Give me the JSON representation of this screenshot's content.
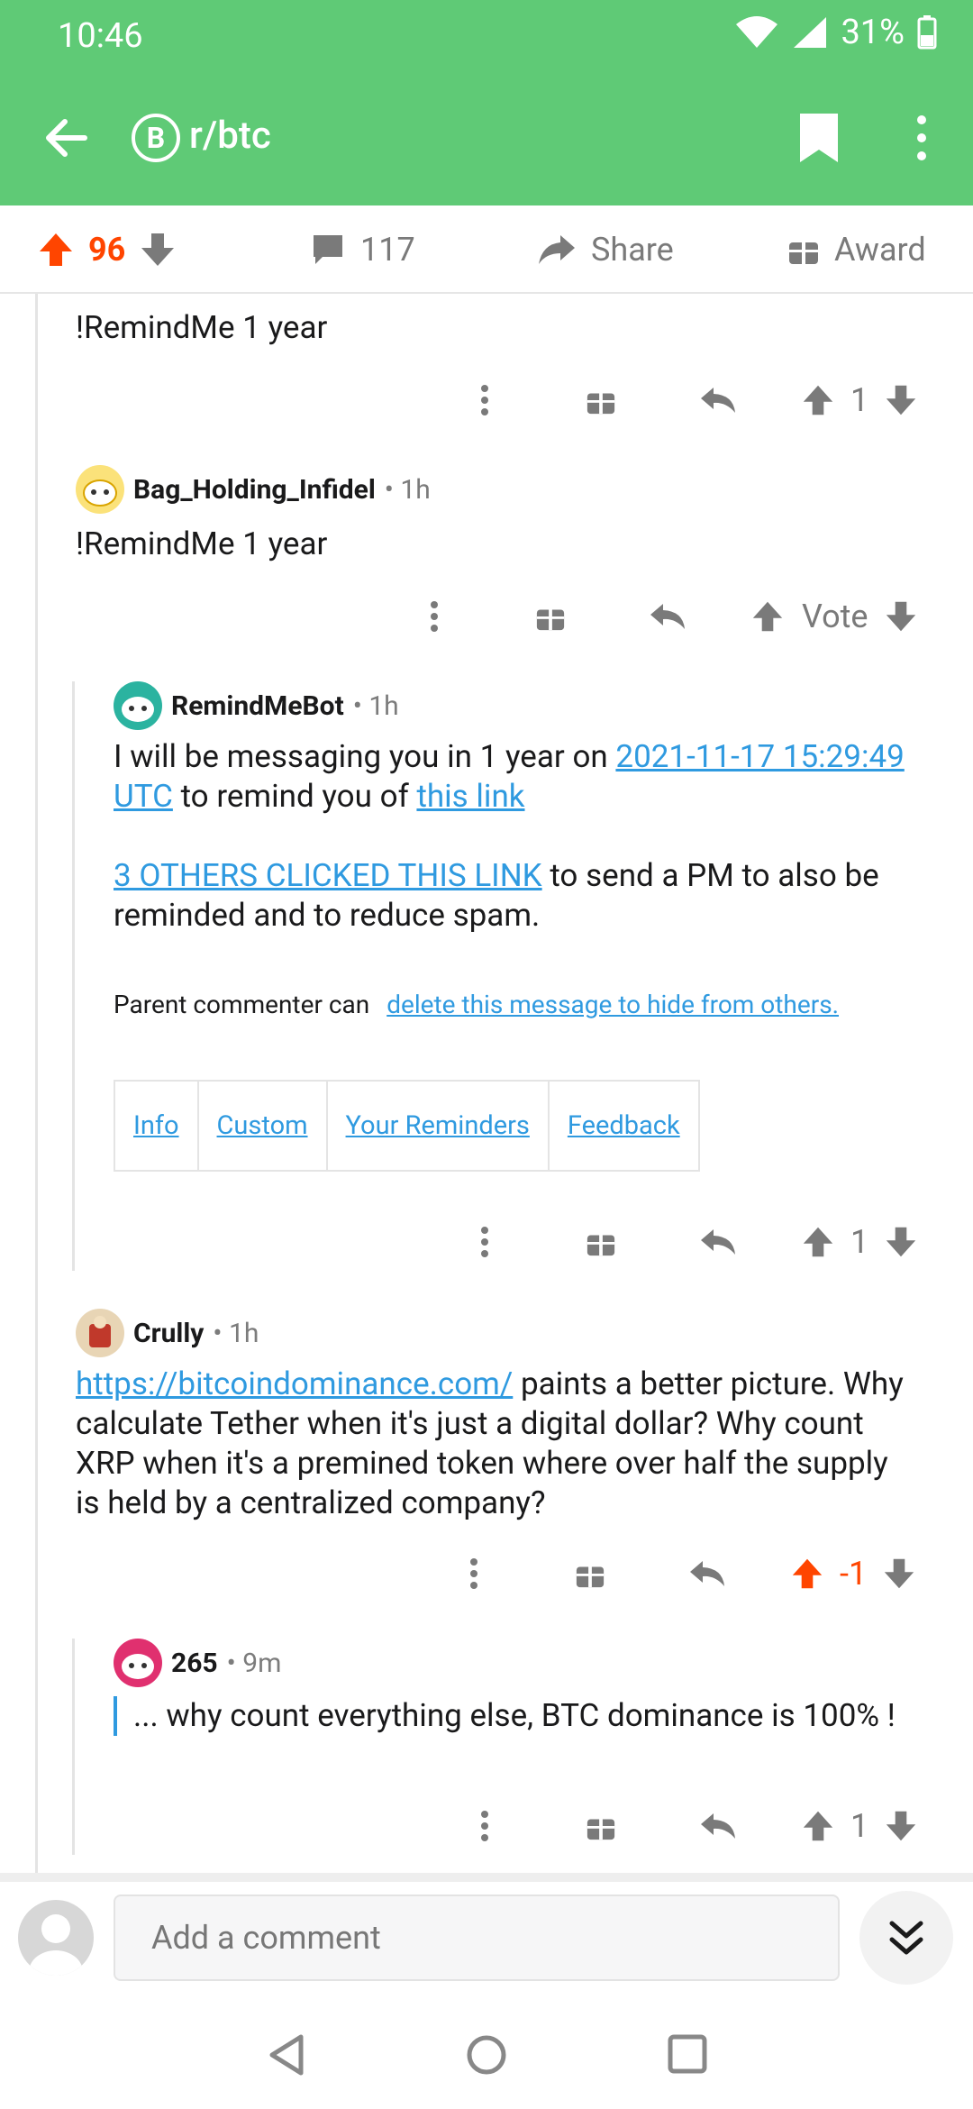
{
  "status": {
    "time": "10:46",
    "battery": "31%"
  },
  "header": {
    "subreddit": "r/btc",
    "sub_icon_glyph": "B"
  },
  "action_bar": {
    "score": "96",
    "comments": "117",
    "share": "Share",
    "award": "Award"
  },
  "comments": [
    {
      "text": "!RemindMe 1 year",
      "score": "1"
    },
    {
      "author": "Bag_Holding_Infidel",
      "time": "• 1h",
      "text": "!RemindMe 1 year",
      "score": "Vote"
    },
    {
      "author": "RemindMeBot",
      "time": "• 1h",
      "line1": "I will be messaging you in 1 year on ",
      "date_link": "2021-11-17 15:29:49",
      "utc_link": "UTC",
      "line2": " to remind you of ",
      "this_link": "this link",
      "others_link": "3 OTHERS CLICKED THIS LINK",
      "line3": " to send a PM to also be",
      "line4": "reminded and to reduce spam.",
      "parent_text": "Parent commenter can",
      "delete_link": "delete this message to hide from others.",
      "table": [
        "Info",
        "Custom",
        "Your Reminders",
        "Feedback"
      ],
      "score": "1"
    },
    {
      "author": "Crully",
      "time": "• 1h",
      "link": "https://bitcoindominance.com/",
      "line1": " paints a better picture. Why",
      "line2": "calculate Tether when it's just a digital dollar?  Why count",
      "line3": "XRP when it's a premined token where over half the supply",
      "line4": "is held by a centralized company?",
      "score": "-1"
    },
    {
      "author": "265",
      "time": "• 9m",
      "quote": "... why count everything else, BTC dominance is 100% !",
      "score": "1"
    }
  ],
  "composer": {
    "placeholder": "Add a comment"
  },
  "colors": {
    "green": "#5fca76",
    "upvote": "#ff4500",
    "link": "#2f9ae0"
  }
}
